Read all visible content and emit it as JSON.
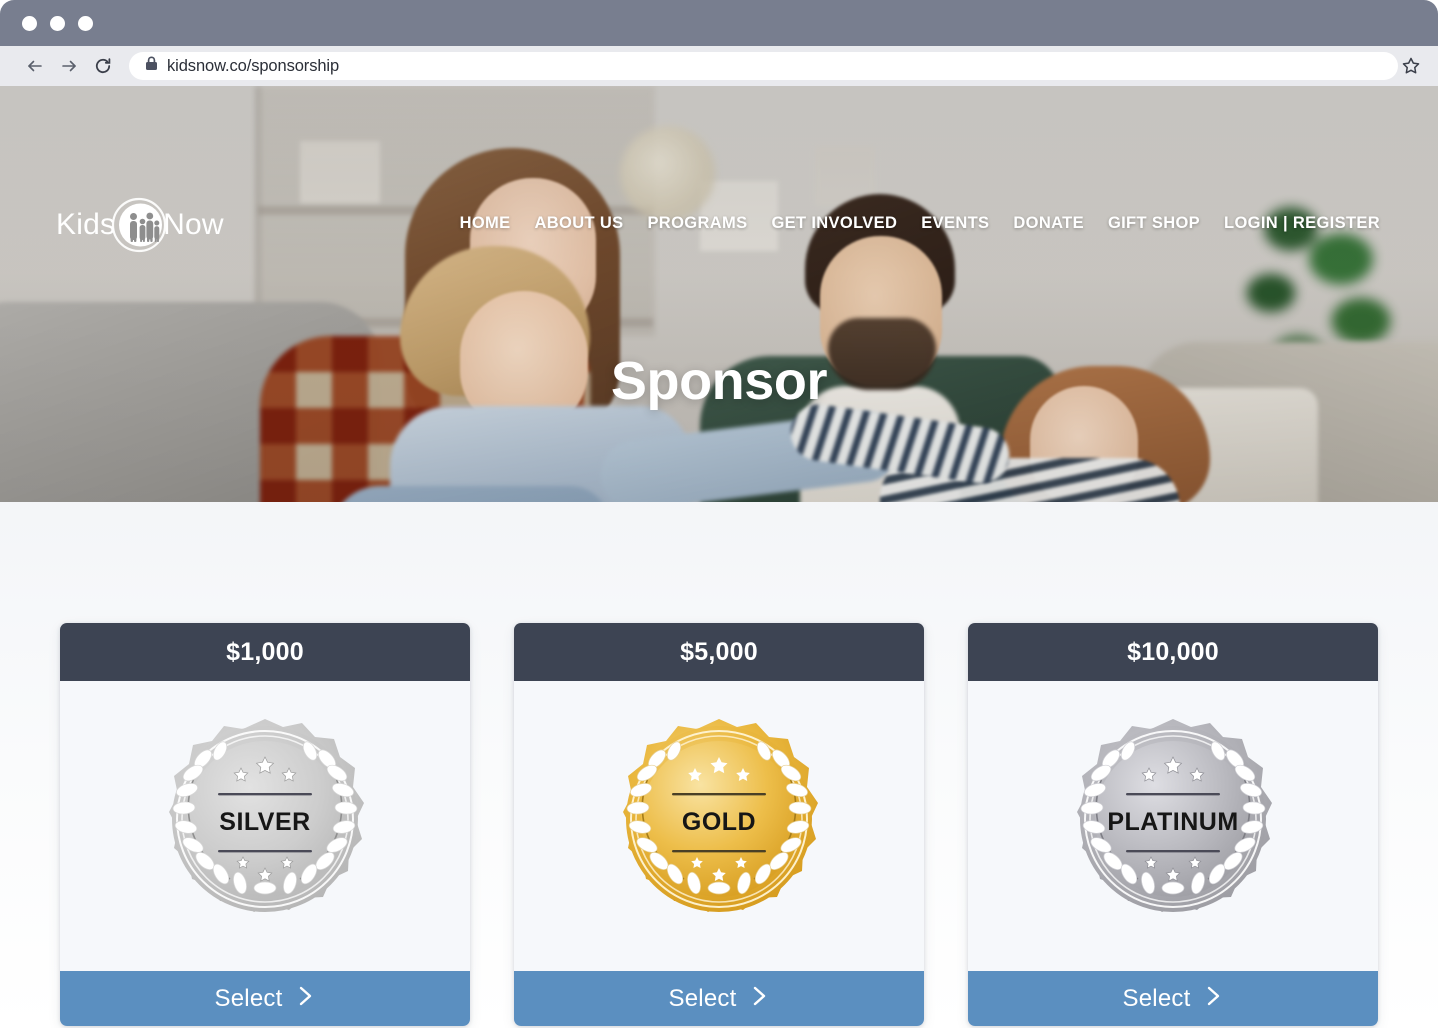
{
  "browser": {
    "window_dots": [
      "dot-1",
      "dot-2",
      "dot-3"
    ],
    "back_icon": "arrow-left-icon",
    "forward_icon": "arrow-right-icon",
    "reload_icon": "reload-icon",
    "lock_icon": "lock-icon",
    "url": "kidsnow.co/sponsorship",
    "url_placeholder": "Search or type a URL",
    "bookmark_icon": "star-icon"
  },
  "site": {
    "logo": {
      "word_left": "Kids",
      "word_right": "Now",
      "mark_icon": "family-circle-icon"
    },
    "nav": [
      {
        "label": "HOME"
      },
      {
        "label": "ABOUT US"
      },
      {
        "label": "PROGRAMS"
      },
      {
        "label": "GET INVOLVED"
      },
      {
        "label": "EVENTS"
      },
      {
        "label": "DONATE"
      },
      {
        "label": "GIFT SHOP"
      },
      {
        "label": "LOGIN | REGISTER"
      }
    ],
    "hero": {
      "title": "Sponsor",
      "image_alt": "family-photo"
    }
  },
  "colors": {
    "titlebar": "#787e8f",
    "toolbar": "#e9eaee",
    "card_header": "#3d4453",
    "card_body": "#f6f8fb",
    "select_button": "#5b8fc0",
    "page_bg_top": "#eceff3",
    "page_bg_bottom": "#ffffff",
    "gold": "#e2a62a",
    "silver": "#c3c3c3",
    "platinum": "#a9a9ae"
  },
  "tiers": [
    {
      "price": "$1,000",
      "badge_label": "SILVER",
      "badge_icon": "silver-seal-icon",
      "badge_color": "#c6c6c6",
      "select_label": "Select",
      "chevron_icon": "chevron-right-icon"
    },
    {
      "price": "$5,000",
      "badge_label": "GOLD",
      "badge_icon": "gold-seal-icon",
      "badge_color": "#e3a825",
      "select_label": "Select",
      "chevron_icon": "chevron-right-icon"
    },
    {
      "price": "$10,000",
      "badge_label": "PLATINUM",
      "badge_icon": "platinum-seal-icon",
      "badge_color": "#a8a8ad",
      "select_label": "Select",
      "chevron_icon": "chevron-right-icon"
    }
  ]
}
